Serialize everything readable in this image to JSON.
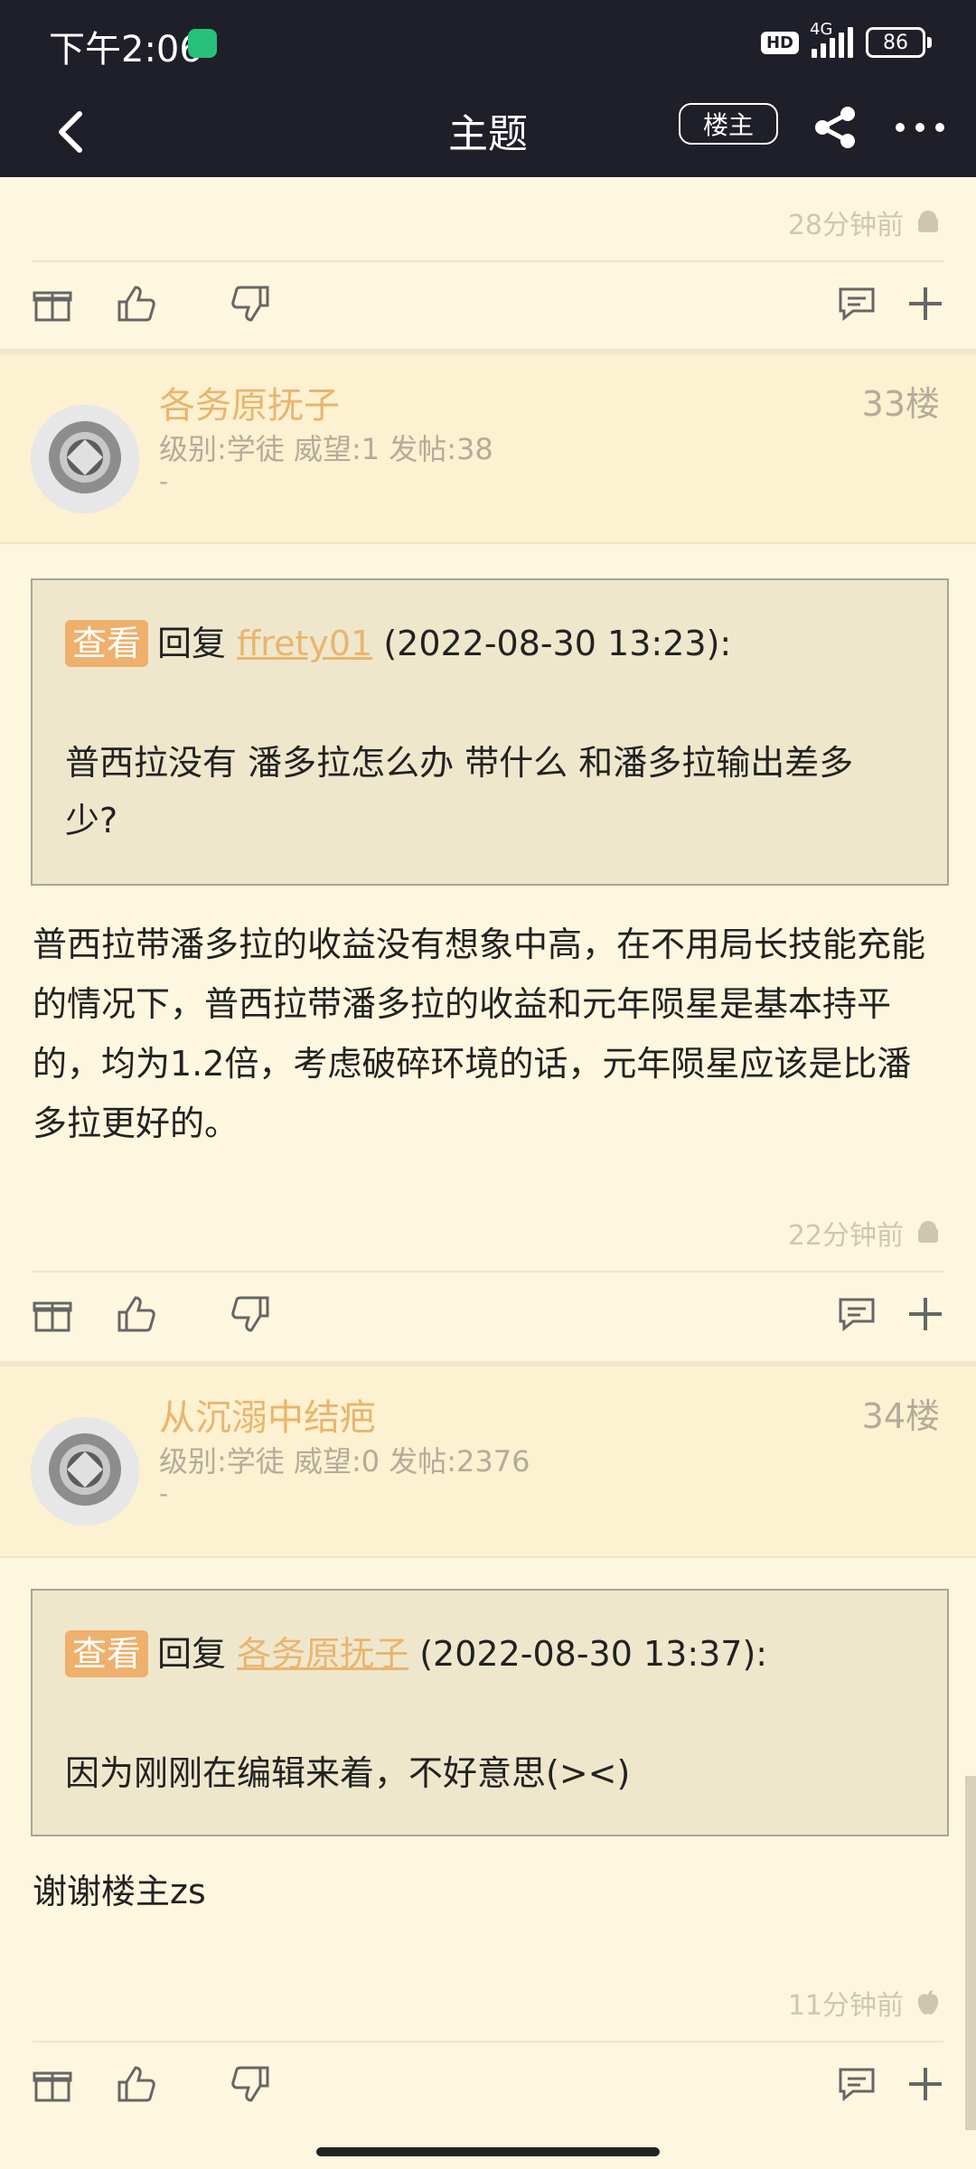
{
  "status_bar": {
    "time": "下午2:06",
    "hd": "HD",
    "network": "4G",
    "battery": "86"
  },
  "nav": {
    "title": "主题",
    "owner_button": "楼主"
  },
  "top_post": {
    "time": "28分钟前"
  },
  "posts": [
    {
      "username": "各务原抚子",
      "meta": "级别:学徒 威望:1 发帖:38",
      "signature": "-",
      "floor": "33楼",
      "quote": {
        "view_label": "查看",
        "reply_label": "回复",
        "reply_user": "ffrety01",
        "date": "(2022-08-30 13:23):",
        "text": "普西拉没有 潘多拉怎么办 带什么 和潘多拉输出差多少?"
      },
      "body": "普西拉带潘多拉的收益没有想象中高，在不用局长技能充能的情况下，普西拉带潘多拉的收益和元年陨星是基本持平的，均为1.2倍，考虑破碎环境的话，元年陨星应该是比潘多拉更好的。",
      "time": "22分钟前"
    },
    {
      "username": "从沉溺中结疤",
      "meta": "级别:学徒 威望:0 发帖:2376",
      "signature": "-",
      "floor": "34楼",
      "quote": {
        "view_label": "查看",
        "reply_label": "回复",
        "reply_user": "各务原抚子",
        "date": "(2022-08-30 13:37):",
        "text": "因为刚刚在编辑来着，不好意思(><)"
      },
      "body": "谢谢楼主zs",
      "time": "11分钟前"
    }
  ]
}
